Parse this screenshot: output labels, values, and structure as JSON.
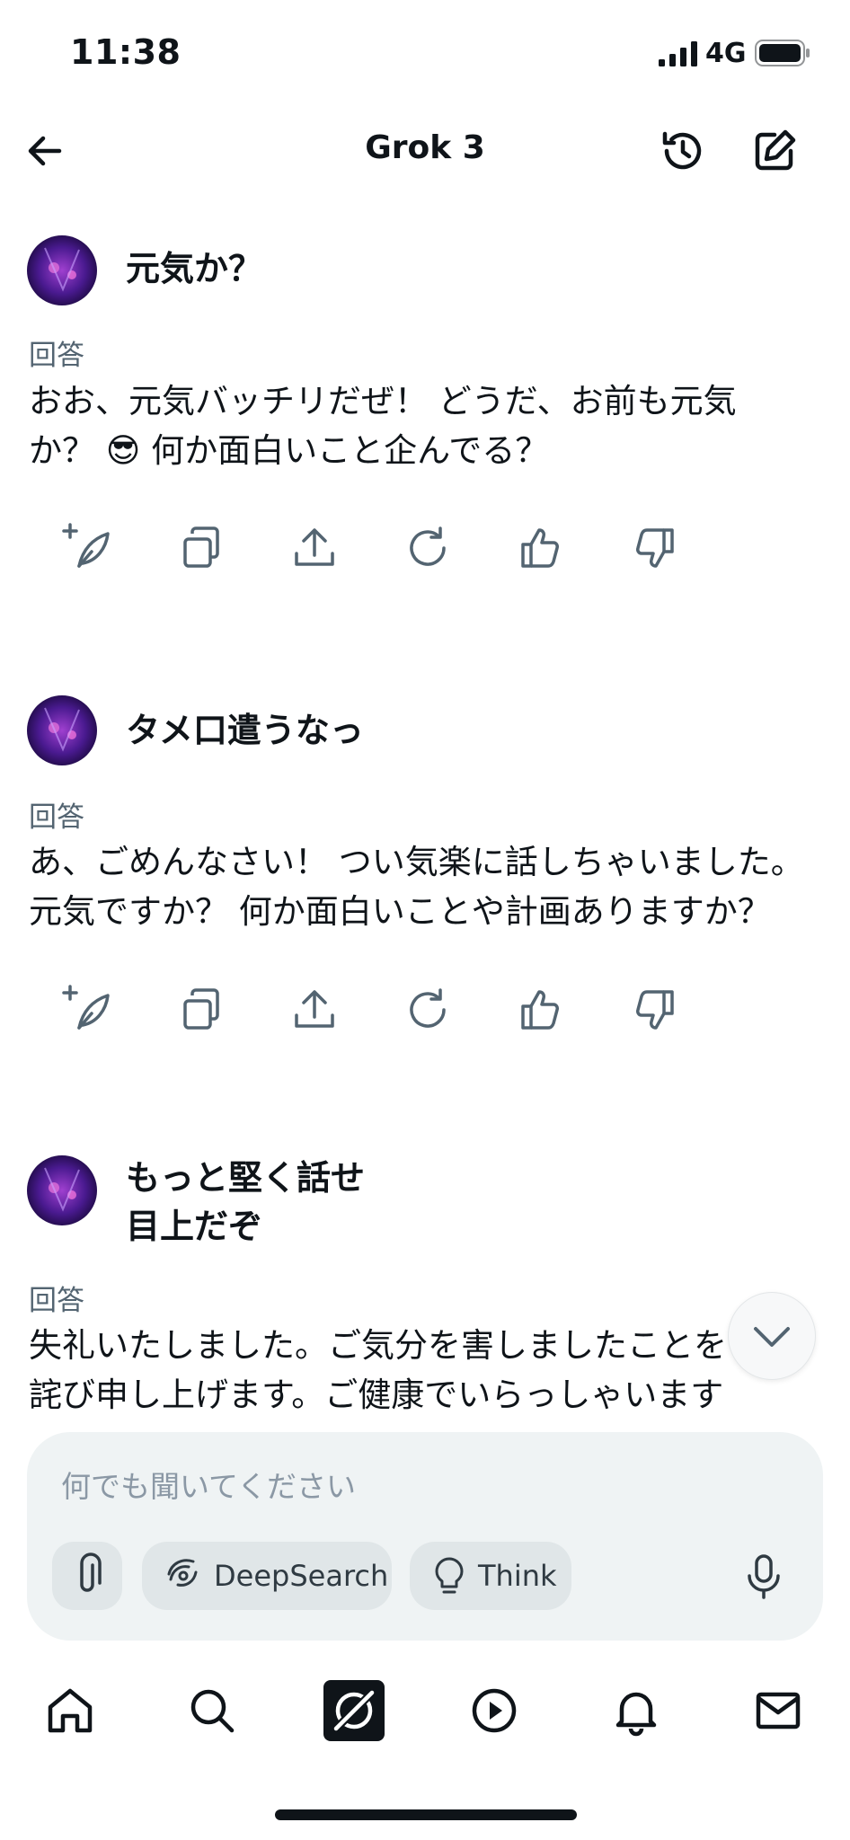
{
  "status_bar": {
    "time": "11:38",
    "network": "4G"
  },
  "header": {
    "title": "Grok 3"
  },
  "messages": [
    {
      "question": "元気か？",
      "answer_label": "回答",
      "answer": "おお、元気バッチリだぜ！ どうだ、お前も元気\nか？ 😎 何か面白いこと企んでる？"
    },
    {
      "question": "タメ口遣うなっ",
      "answer_label": "回答",
      "answer": "あ、ごめんなさい！ つい気楽に話しちゃいました。\n元気ですか？ 何か面白いことや計画ありますか？"
    },
    {
      "question": "もっと堅く話せ\n目上だぞ",
      "answer_label": "回答",
      "answer": "失礼いたしました。ご気分を害しましたことを\n詫び申し上げます。ご健康でいらっしゃいます"
    }
  ],
  "composer": {
    "placeholder": "何でも聞いてください",
    "deepsearch_label": "DeepSearch",
    "think_label": "Think"
  },
  "icons": [
    "back-arrow-icon",
    "history-icon",
    "compose-icon",
    "regenerate-feather-icon",
    "copy-icon",
    "share-icon",
    "refresh-icon",
    "thumbs-up-icon",
    "thumbs-down-icon",
    "chevron-down-icon",
    "paperclip-icon",
    "deepsearch-icon",
    "lightbulb-icon",
    "microphone-icon",
    "home-icon",
    "search-icon",
    "grok-icon",
    "play-icon",
    "bell-icon",
    "mail-icon"
  ],
  "colors": {
    "text": "#0f1419",
    "secondary": "#536471",
    "composer_bg": "#eff3f4",
    "chip_bg": "#e0e6e8"
  }
}
